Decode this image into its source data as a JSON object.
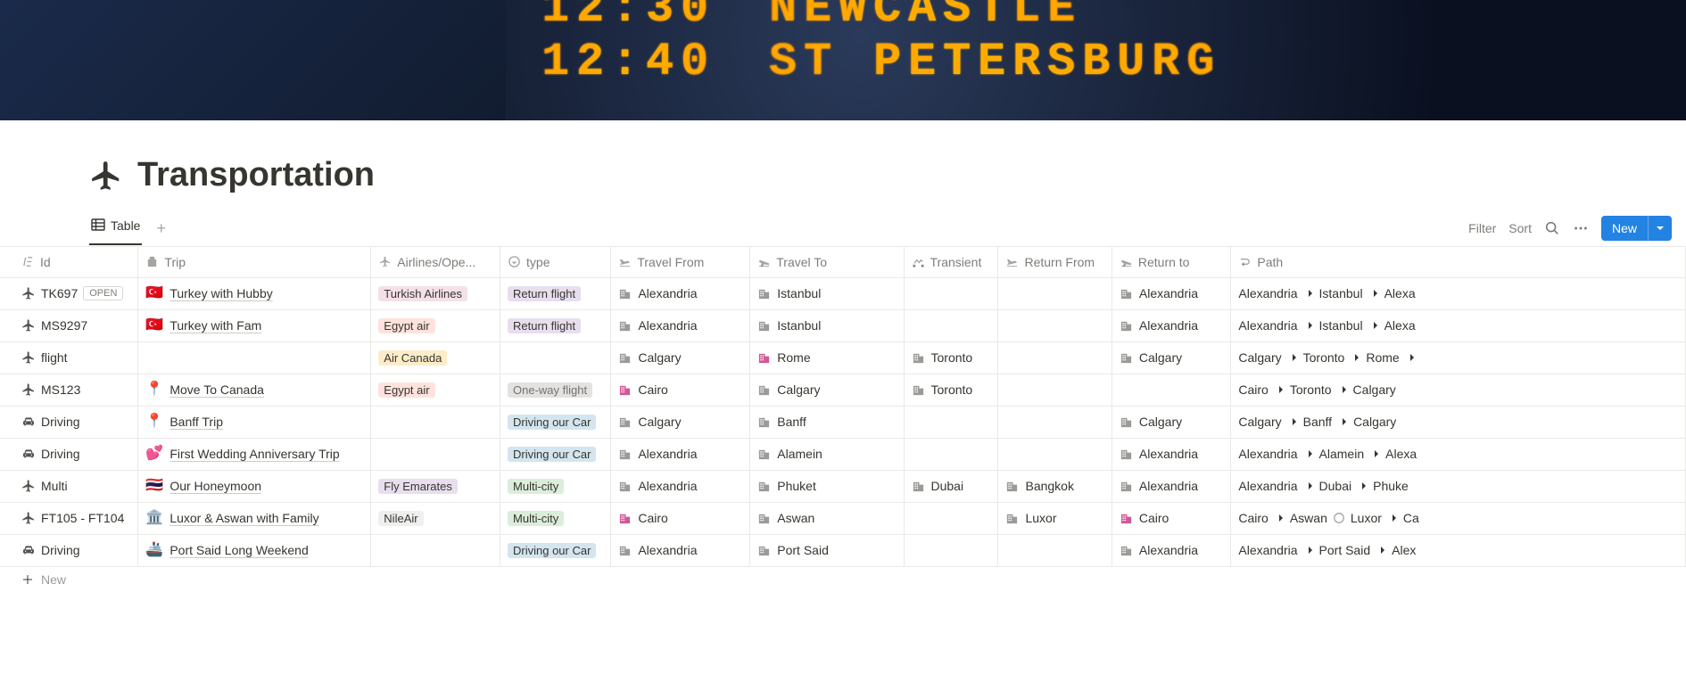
{
  "page": {
    "title": "Transportation"
  },
  "tabs": {
    "table_label": "Table"
  },
  "toolbar": {
    "filter": "Filter",
    "sort": "Sort",
    "new": "New"
  },
  "columns": {
    "id": "Id",
    "trip": "Trip",
    "operator": "Airlines/Ope...",
    "type": "type",
    "from": "Travel From",
    "to": "Travel To",
    "transient": "Transient",
    "return_from": "Return From",
    "return_to": "Return to",
    "path": "Path"
  },
  "rows": [
    {
      "id_icon": "plane",
      "id": "TK697",
      "open": true,
      "trip_emoji": "🇹🇷",
      "trip": "Turkey with Hubby",
      "operator": "Turkish Airlines",
      "operator_color": "pink",
      "type": "Return flight",
      "type_color": "purple",
      "from": "Alexandria",
      "to": "Istanbul",
      "transient": null,
      "return_from": null,
      "return_to": "Alexandria",
      "path": [
        "Alexandria",
        "Istanbul",
        "Alexa"
      ]
    },
    {
      "id_icon": "plane",
      "id": "MS9297",
      "trip_emoji": "🇹🇷",
      "trip": "Turkey with Fam",
      "operator": "Egypt air",
      "operator_color": "red",
      "type": "Return flight",
      "type_color": "purple",
      "from": "Alexandria",
      "to": "Istanbul",
      "transient": null,
      "return_from": null,
      "return_to": "Alexandria",
      "path": [
        "Alexandria",
        "Istanbul",
        "Alexa"
      ]
    },
    {
      "id_icon": "plane",
      "id": "flight",
      "trip_emoji": null,
      "trip": null,
      "operator": "Air Canada",
      "operator_color": "yellow",
      "type": null,
      "type_color": null,
      "from": "Calgary",
      "to": "Rome",
      "to_pink": true,
      "transient": "Toronto",
      "return_from": null,
      "return_to": "Calgary",
      "path": [
        "Calgary",
        "Toronto",
        "Rome"
      ],
      "path_tail": true
    },
    {
      "id_icon": "plane",
      "id": "MS123",
      "trip_emoji": "📍",
      "trip": "Move To Canada",
      "operator": "Egypt air",
      "operator_color": "red",
      "type": "One-way flight",
      "type_color": "gray",
      "from": "Cairo",
      "from_pink": true,
      "to": "Calgary",
      "transient": "Toronto",
      "return_from": null,
      "return_to": null,
      "path": [
        "Cairo",
        "Toronto",
        "Calgary"
      ]
    },
    {
      "id_icon": "car",
      "id": "Driving",
      "trip_emoji": "📍",
      "trip": "Banff Trip",
      "operator": null,
      "operator_color": null,
      "type": "Driving our Car",
      "type_color": "blue",
      "from": "Calgary",
      "to": "Banff",
      "transient": null,
      "return_from": null,
      "return_to": "Calgary",
      "path": [
        "Calgary",
        "Banff",
        "Calgary"
      ]
    },
    {
      "id_icon": "car",
      "id": "Driving",
      "trip_emoji": "💕",
      "trip": "First Wedding Anniversary Trip",
      "operator": null,
      "operator_color": null,
      "type": "Driving our Car",
      "type_color": "blue",
      "from": "Alexandria",
      "to": "Alamein",
      "transient": null,
      "return_from": null,
      "return_to": "Alexandria",
      "path": [
        "Alexandria",
        "Alamein",
        "Alexa"
      ]
    },
    {
      "id_icon": "plane",
      "id": "Multi",
      "trip_emoji": "🇹🇭",
      "trip": "Our Honeymoon",
      "operator": "Fly Emarates",
      "operator_color": "purple",
      "type": "Multi-city",
      "type_color": "green",
      "from": "Alexandria",
      "to": "Phuket",
      "transient": "Dubai",
      "return_from": "Bangkok",
      "return_to": "Alexandria",
      "path": [
        "Alexandria",
        "Dubai",
        "Phuke"
      ]
    },
    {
      "id_icon": "plane",
      "id": "FT105 - FT104",
      "trip_emoji": "🏛️",
      "trip": "Luxor & Aswan with Family",
      "operator": "NileAir",
      "operator_color": "lgray",
      "type": "Multi-city",
      "type_color": "green",
      "from": "Cairo",
      "from_pink": true,
      "to": "Aswan",
      "transient": null,
      "return_from": "Luxor",
      "return_to": "Cairo",
      "return_to_pink": true,
      "path_special": [
        "Cairo",
        "→",
        "Aswan",
        "⛴",
        "Luxor",
        "→",
        "Ca"
      ]
    },
    {
      "id_icon": "car",
      "id": "Driving",
      "trip_emoji": "🚢",
      "trip": "Port Said Long Weekend",
      "operator": null,
      "operator_color": null,
      "type": "Driving our Car",
      "type_color": "blue",
      "from": "Alexandria",
      "to": "Port Said",
      "transient": null,
      "return_from": null,
      "return_to": "Alexandria",
      "path": [
        "Alexandria",
        "Port Said",
        "Alex"
      ]
    }
  ],
  "new_row": "New"
}
